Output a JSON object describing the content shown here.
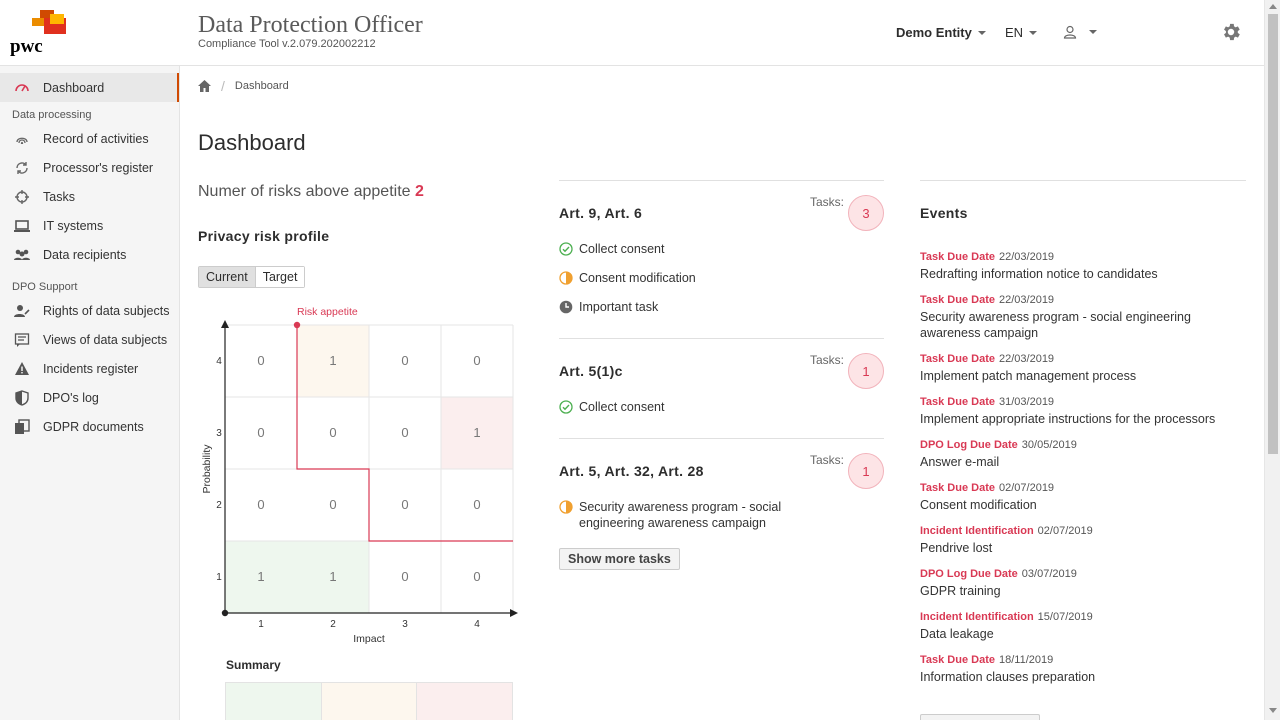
{
  "header": {
    "logo_text": "pwc",
    "title": "Data Protection Officer",
    "subtitle": "Compliance Tool v.2.079.202002212",
    "entity": "Demo Entity",
    "language": "EN"
  },
  "sidebar": {
    "dashboard": "Dashboard",
    "section_processing": "Data processing",
    "processing_items": [
      {
        "label": "Record of activities",
        "icon": "fingerprint-icon"
      },
      {
        "label": "Processor's register",
        "icon": "sync-icon"
      },
      {
        "label": "Tasks",
        "icon": "crosshair-icon"
      },
      {
        "label": "IT systems",
        "icon": "laptop-icon"
      },
      {
        "label": "Data recipients",
        "icon": "group-icon"
      }
    ],
    "section_support": "DPO Support",
    "support_items": [
      {
        "label": "Rights of data subjects",
        "icon": "user-edit-icon"
      },
      {
        "label": "Views of data subjects",
        "icon": "comment-icon"
      },
      {
        "label": "Incidents register",
        "icon": "warning-icon"
      },
      {
        "label": "DPO's log",
        "icon": "shield-icon"
      },
      {
        "label": "GDPR documents",
        "icon": "documents-icon"
      }
    ]
  },
  "breadcrumb": {
    "current": "Dashboard"
  },
  "page_title": "Dashboard",
  "risk_summary": {
    "label": "Numer of risks above appetite",
    "count": "2"
  },
  "profile": {
    "title": "Privacy risk profile",
    "toggle_current": "Current",
    "toggle_target": "Target",
    "risk_appetite_label": "Risk appetite",
    "x_label": "Impact",
    "y_label": "Probability",
    "x_ticks": [
      "1",
      "2",
      "3",
      "4"
    ],
    "y_ticks": [
      "4",
      "3",
      "2",
      "1"
    ],
    "grid": [
      [
        "0",
        "1",
        "0",
        "0"
      ],
      [
        "0",
        "0",
        "0",
        "1"
      ],
      [
        "0",
        "0",
        "0",
        "0"
      ],
      [
        "1",
        "1",
        "0",
        "0"
      ]
    ],
    "summary_title": "Summary"
  },
  "colors": {
    "accent": "#d93954",
    "brand": "#d04a02",
    "low": "#eef7ee",
    "medium": "#fdf7ee",
    "high": "#fbeeee"
  },
  "task_groups": [
    {
      "title": "Art. 9, Art. 6",
      "tasks_label": "Tasks:",
      "count": "3",
      "items": [
        {
          "label": "Collect consent",
          "status": "done"
        },
        {
          "label": "Consent modification",
          "status": "in-progress"
        },
        {
          "label": "Important task",
          "status": "pending"
        }
      ]
    },
    {
      "title": "Art. 5(1)c",
      "tasks_label": "Tasks:",
      "count": "1",
      "items": [
        {
          "label": "Collect consent",
          "status": "done"
        }
      ]
    },
    {
      "title": "Art. 5, Art. 32, Art. 28",
      "tasks_label": "Tasks:",
      "count": "1",
      "items": [
        {
          "label": "Security awareness program - social engineering awareness campaign",
          "status": "in-progress"
        }
      ]
    }
  ],
  "show_more_tasks": "Show more tasks",
  "events": {
    "title": "Events",
    "items": [
      {
        "type": "Task Due Date",
        "date": "22/03/2019",
        "desc": "Redrafting information notice to candidates"
      },
      {
        "type": "Task Due Date",
        "date": "22/03/2019",
        "desc": "Security awareness program - social engineering awareness campaign"
      },
      {
        "type": "Task Due Date",
        "date": "22/03/2019",
        "desc": "Implement patch management process"
      },
      {
        "type": "Task Due Date",
        "date": "31/03/2019",
        "desc": "Implement appropriate instructions for the processors"
      },
      {
        "type": "DPO Log Due Date",
        "date": "30/05/2019",
        "desc": "Answer e-mail"
      },
      {
        "type": "Task Due Date",
        "date": "02/07/2019",
        "desc": "Consent modification"
      },
      {
        "type": "Incident Identification",
        "date": "02/07/2019",
        "desc": "Pendrive lost"
      },
      {
        "type": "DPO Log Due Date",
        "date": "03/07/2019",
        "desc": "GDPR training"
      },
      {
        "type": "Incident Identification",
        "date": "15/07/2019",
        "desc": "Data leakage"
      },
      {
        "type": "Task Due Date",
        "date": "18/11/2019",
        "desc": "Information clauses preparation"
      }
    ]
  }
}
